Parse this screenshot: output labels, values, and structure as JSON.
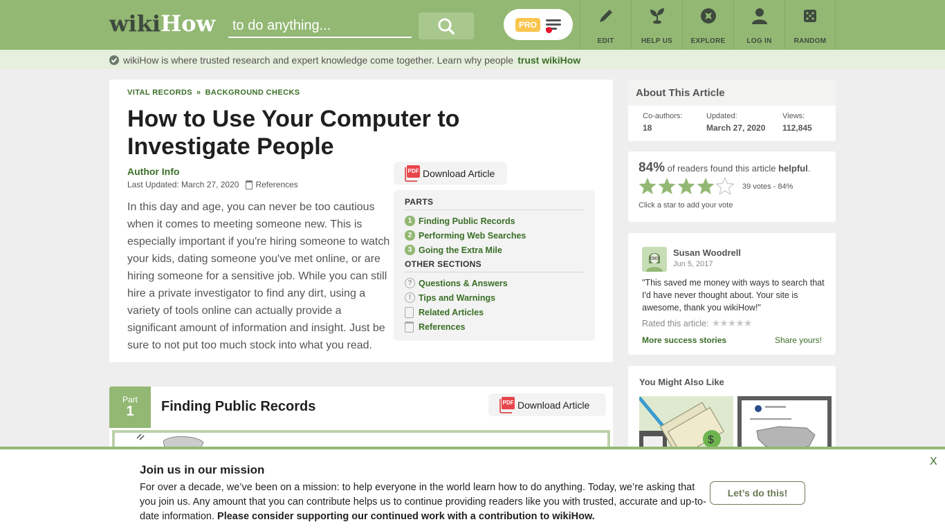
{
  "header": {
    "logo_wiki": "wiki",
    "logo_how": "How",
    "search_placeholder": "to do anything...",
    "pro_label": "PRO",
    "nav": [
      {
        "label": "EDIT",
        "icon": "pencil-icon"
      },
      {
        "label": "HELP US",
        "icon": "sprout-icon"
      },
      {
        "label": "EXPLORE",
        "icon": "compass-icon"
      },
      {
        "label": "LOG IN",
        "icon": "user-icon"
      },
      {
        "label": "RANDOM",
        "icon": "dice-icon"
      }
    ]
  },
  "trustbar": {
    "text": "wikiHow is where trusted research and expert knowledge come together. Learn why people",
    "link": "trust wikiHow"
  },
  "article": {
    "breadcrumbs": [
      "VITAL RECORDS",
      "BACKGROUND CHECKS"
    ],
    "breadcrumb_sep": "»",
    "title": "How to Use Your Computer to Investigate People",
    "author_label": "Author Info",
    "last_updated": "Last Updated: March 27, 2020",
    "references_label": "References",
    "intro": "In this day and age, you can never be too cautious when it comes to meeting someone new. This is especially important if you're hiring someone to watch your kids, dating someone you've met online, or are hiring someone for a sensitive job. While you can still hire a private investigator to find any dirt, using a variety of tools online can actually provide a significant amount of information and insight. Just be sure to not put too much stock into what you read.",
    "download_label": "Download Article",
    "pdf_label": "PDF",
    "toc": {
      "parts_heading": "PARTS",
      "parts": [
        {
          "num": "1",
          "label": "Finding Public Records"
        },
        {
          "num": "2",
          "label": "Performing Web Searches"
        },
        {
          "num": "3",
          "label": "Going the Extra Mile"
        }
      ],
      "other_heading": "OTHER SECTIONS",
      "other": [
        {
          "icon": "?",
          "label": "Questions & Answers"
        },
        {
          "icon": "!",
          "label": "Tips and Warnings"
        },
        {
          "icon": "",
          "label": "Related Articles"
        },
        {
          "icon": "",
          "label": "References"
        }
      ]
    },
    "part1": {
      "part_label": "Part",
      "part_num": "1",
      "title": "Finding Public Records",
      "download_label": "Download Article"
    }
  },
  "sidebar": {
    "about": {
      "title": "About This Article",
      "coauthors_label": "Co-authors:",
      "coauthors": "18",
      "updated_label": "Updated:",
      "updated": "March 27, 2020",
      "views_label": "Views:",
      "views": "112,845"
    },
    "rating": {
      "percent": "84%",
      "text": "of readers found this article",
      "helpful": "helpful",
      "stars_filled": 4,
      "stars_total": 5,
      "votes": "39 votes - 84%",
      "click_hint": "Click a star to add your vote"
    },
    "story": {
      "name": "Susan Woodrell",
      "date": "Jun 5, 2017",
      "quote": "\"This saved me money with ways to search that I'd have never thought about. Your site is awesome, thank you wikiHow!\"",
      "rated_label": "Rated this article:",
      "more_label": "More success stories",
      "share_label": "Share yours!"
    },
    "ymal": {
      "title": "You Might Also Like"
    }
  },
  "banner": {
    "title": "Join us in our mission",
    "body": "For over a decade, we’ve been on a mission: to help everyone in the world learn how to do anything. Today, we’re asking that you join us. Any amount that you can contribute helps us to continue providing readers like you with trusted, accurate and up-to-date information.",
    "body_bold": "Please consider supporting our continued work with a contribution to wikiHow.",
    "cta": "Let’s do this!",
    "close": "X"
  },
  "colors": {
    "brand_green": "#93b874",
    "link_green": "#3a6e27",
    "pro_yellow": "#f9c54d",
    "pdf_red": "#e8464c"
  }
}
